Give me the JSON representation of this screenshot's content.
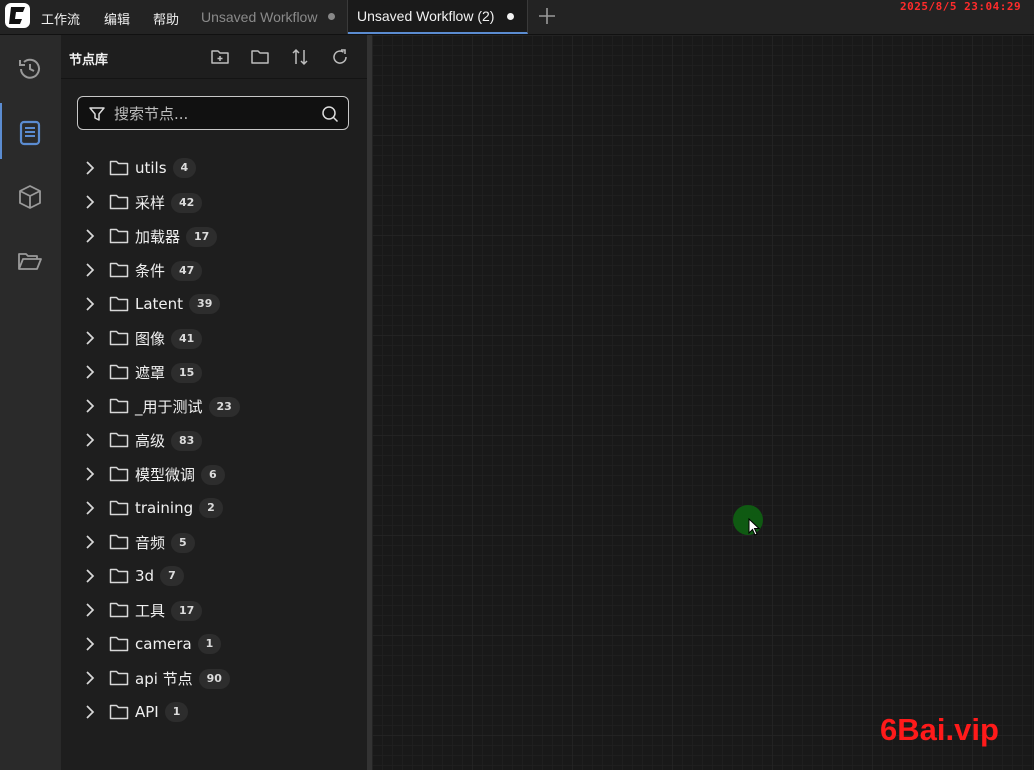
{
  "app": {
    "logo": "comfy-logo",
    "menu": [
      "工作流",
      "编辑",
      "帮助"
    ],
    "tabs": [
      {
        "label": "Unsaved Workflow",
        "active": false
      },
      {
        "label": "Unsaved Workflow (2)",
        "active": true
      }
    ],
    "add_tab_icon": "plus-icon",
    "clock": "2025/8/5  23:04:29"
  },
  "rail": {
    "items": [
      {
        "icon": "history-icon",
        "active": false
      },
      {
        "icon": "node-library-icon",
        "active": true
      },
      {
        "icon": "model-library-icon",
        "active": false
      },
      {
        "icon": "workflows-icon",
        "active": false
      }
    ]
  },
  "node_library": {
    "title": "节点库",
    "tools": [
      "new-folder-icon",
      "folder-icon",
      "sort-icon",
      "refresh-icon"
    ],
    "search": {
      "placeholder": "搜索节点...",
      "value": ""
    },
    "categories": [
      {
        "label": "utils",
        "count": "4"
      },
      {
        "label": "采样",
        "count": "42"
      },
      {
        "label": "加载器",
        "count": "17"
      },
      {
        "label": "条件",
        "count": "47"
      },
      {
        "label": "Latent",
        "count": "39"
      },
      {
        "label": "图像",
        "count": "41"
      },
      {
        "label": "遮罩",
        "count": "15"
      },
      {
        "label": "_用于测试",
        "count": "23"
      },
      {
        "label": "高级",
        "count": "83"
      },
      {
        "label": "模型微调",
        "count": "6"
      },
      {
        "label": "training",
        "count": "2"
      },
      {
        "label": "音频",
        "count": "5"
      },
      {
        "label": "3d",
        "count": "7"
      },
      {
        "label": "工具",
        "count": "17"
      },
      {
        "label": "camera",
        "count": "1"
      },
      {
        "label": "api 节点",
        "count": "90"
      },
      {
        "label": "API",
        "count": "1"
      }
    ]
  },
  "canvas": {
    "watermark": "6Bai.vip"
  },
  "colors": {
    "accent": "#5b8cd1",
    "clock": "#ff2b2b",
    "watermark": "#ff1a1a",
    "click_indicator": "#0f5a12"
  }
}
